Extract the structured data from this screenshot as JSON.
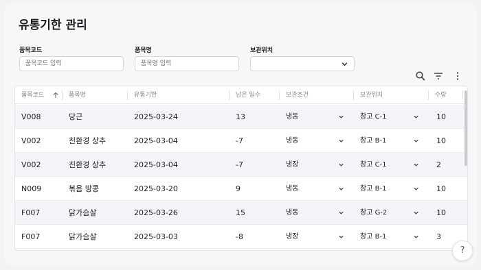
{
  "page": {
    "title": "유통기한 관리"
  },
  "filters": {
    "code": {
      "label": "품목코드",
      "placeholder": "품목코드 입력"
    },
    "name": {
      "label": "품목명",
      "placeholder": "품목명 입력"
    },
    "location": {
      "label": "보관위치",
      "value": ""
    }
  },
  "toolbar": {
    "icons": [
      "search-icon",
      "filter-icon",
      "more-vertical-icon"
    ]
  },
  "table": {
    "columns": [
      "품목코드",
      "품목명",
      "유통기한",
      "남은 일수",
      "보관조건",
      "보관위치",
      "수량"
    ],
    "sort_column": "품목코드",
    "rows": [
      {
        "code": "V008",
        "name": "당근",
        "expiry": "2025-03-24",
        "days": "13",
        "storage": "냉동",
        "location": "창고 C-1",
        "qty": "10"
      },
      {
        "code": "V002",
        "name": "친환경 상추",
        "expiry": "2025-03-04",
        "days": "-7",
        "storage": "냉동",
        "location": "창고 B-1",
        "qty": "10"
      },
      {
        "code": "V002",
        "name": "친환경 상추",
        "expiry": "2025-03-04",
        "days": "-7",
        "storage": "냉장",
        "location": "창고 C-1",
        "qty": "2"
      },
      {
        "code": "N009",
        "name": "볶음 땅콩",
        "expiry": "2025-03-20",
        "days": "9",
        "storage": "냉동",
        "location": "창고 B-1",
        "qty": "10"
      },
      {
        "code": "F007",
        "name": "닭가슴살",
        "expiry": "2025-03-26",
        "days": "15",
        "storage": "냉동",
        "location": "창고 G-2",
        "qty": "10"
      },
      {
        "code": "F007",
        "name": "닭가슴살",
        "expiry": "2025-03-03",
        "days": "-8",
        "storage": "냉장",
        "location": "창고 B-1",
        "qty": "3"
      }
    ]
  },
  "help": {
    "label": "?"
  },
  "colors": {
    "accent_row": "#f3f5f9",
    "border": "#e4e4e8",
    "background": "#f7f7f8"
  }
}
